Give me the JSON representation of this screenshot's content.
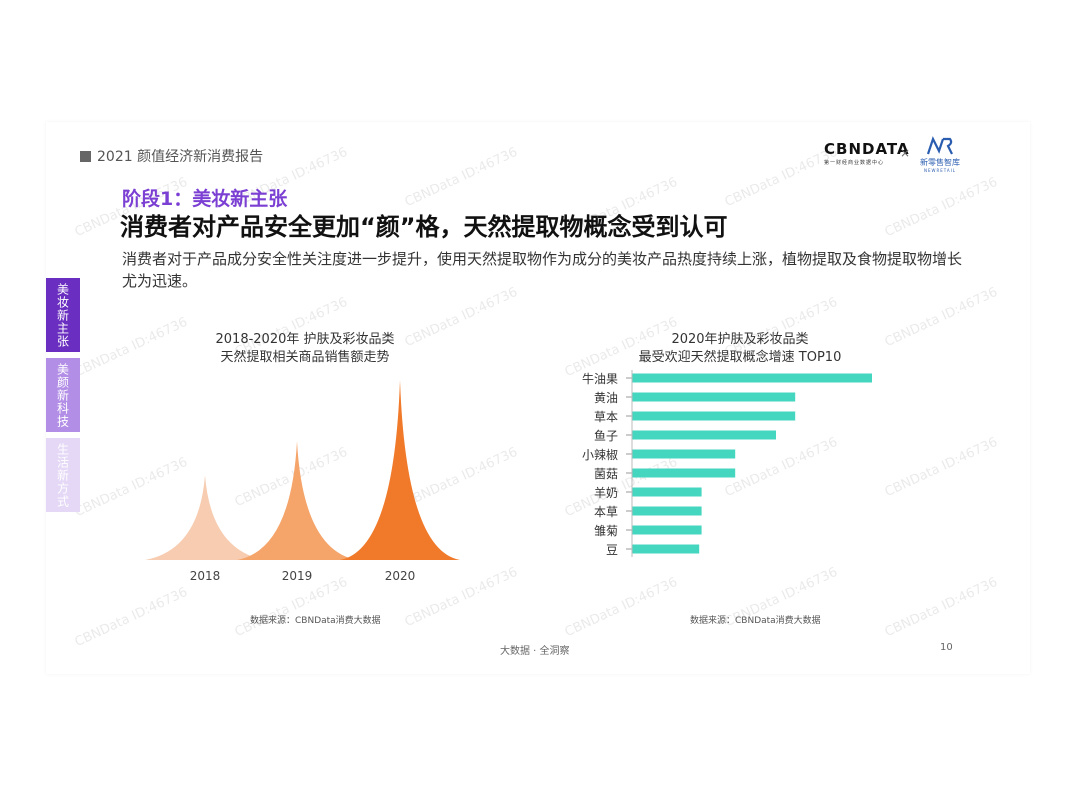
{
  "header": {
    "report_title": "2021 颜值经济新消费报告",
    "logo_main": "CBNDATA",
    "logo_main_sub": "第一财经商业数据中心",
    "logo_x": "×",
    "logo_partner": "新零售智库",
    "logo_partner_sub": "NEWRETAIL"
  },
  "stage_label": "阶段1：美妆新主张",
  "headline": "消费者对产品安全更加“颜”格，天然提取物概念受到认可",
  "description": "消费者对于产品成分安全性关注度进一步提升，使用天然提取物作为成分的美妆产品热度持续上涨，植物提取及食物提取物增长尤为迅速。",
  "side_tabs": [
    {
      "label": "美妆新主张"
    },
    {
      "label": "美颜新科技"
    },
    {
      "label": "生活新方式"
    }
  ],
  "watermark": "CBNData ID:46736",
  "chart_data": [
    {
      "type": "area",
      "title_lines": [
        "2018-2020年 护肤及彩妆品类",
        "天然提取相关商品销售额走势"
      ],
      "categories": [
        "2018",
        "2019",
        "2020"
      ],
      "values": [
        47,
        66,
        100
      ],
      "colors": [
        "#f7ccb0",
        "#f5a46a",
        "#f07a2a"
      ],
      "source": "数据来源：CBNData消费大数据"
    },
    {
      "type": "bar",
      "title_lines": [
        "2020年护肤及彩妆品类",
        "最受欢迎天然提取概念增速 TOP10"
      ],
      "categories": [
        "牛油果",
        "黄油",
        "草本",
        "鱼子",
        "小辣椒",
        "菌菇",
        "羊奶",
        "本草",
        "雏菊",
        "豆"
      ],
      "values": [
        100,
        68,
        68,
        60,
        43,
        43,
        29,
        29,
        29,
        28
      ],
      "color": "#45d6bf",
      "source": "数据来源：CBNData消费大数据"
    }
  ],
  "footer": "大数据 · 全洞察",
  "page_number": "10"
}
